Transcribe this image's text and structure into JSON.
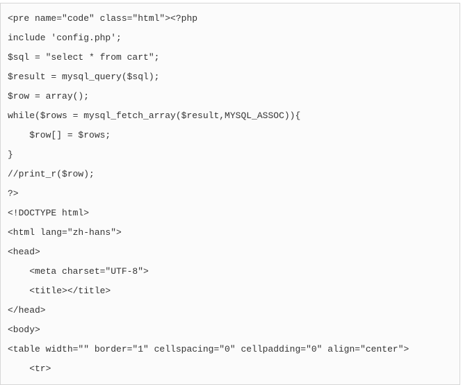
{
  "code": {
    "lines": [
      "<pre name=\"code\" class=\"html\"><?php",
      "",
      "include 'config.php';",
      "$sql = \"select * from cart\";",
      "$result = mysql_query($sql);",
      "$row = array();",
      "while($rows = mysql_fetch_array($result,MYSQL_ASSOC)){",
      "    $row[] = $rows;",
      "}",
      "//print_r($row);",
      "?>",
      "<!DOCTYPE html>",
      "<html lang=\"zh-hans\">",
      "<head>",
      "    <meta charset=\"UTF-8\">",
      "    <title></title>",
      "</head>",
      "<body>",
      "<table width=\"\" border=\"1\" cellspacing=\"0\" cellpadding=\"0\" align=\"center\">",
      "    <tr>"
    ]
  }
}
